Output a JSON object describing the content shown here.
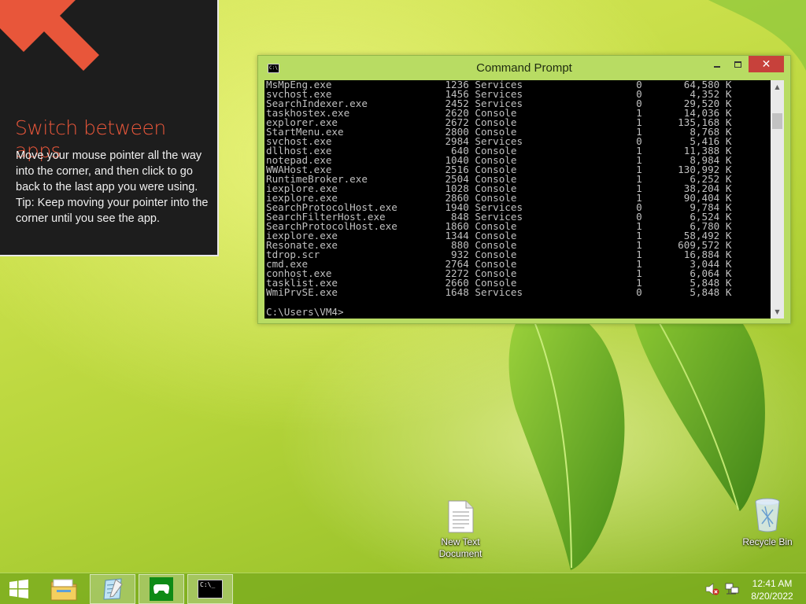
{
  "tip": {
    "title": "Switch between apps",
    "body_lines": [
      "Move your mouse pointer all the way into the corner, and then click to go back to the last app you were using.",
      "Tip: Keep moving your pointer into the corner until you see the app."
    ],
    "arrow_icon": "corner-arrow-icon",
    "accent_color": "#e8563a"
  },
  "cmd": {
    "title": "Command Prompt",
    "rows": [
      [
        "MsMpEng.exe",
        "1236",
        "Services",
        "0",
        "64,580 K"
      ],
      [
        "svchost.exe",
        "1456",
        "Services",
        "0",
        "4,352 K"
      ],
      [
        "SearchIndexer.exe",
        "2452",
        "Services",
        "0",
        "29,520 K"
      ],
      [
        "taskhostex.exe",
        "2620",
        "Console",
        "1",
        "14,036 K"
      ],
      [
        "explorer.exe",
        "2672",
        "Console",
        "1",
        "135,168 K"
      ],
      [
        "StartMenu.exe",
        "2800",
        "Console",
        "1",
        "8,768 K"
      ],
      [
        "svchost.exe",
        "2984",
        "Services",
        "0",
        "5,416 K"
      ],
      [
        "dllhost.exe",
        "640",
        "Console",
        "1",
        "11,388 K"
      ],
      [
        "notepad.exe",
        "1040",
        "Console",
        "1",
        "8,984 K"
      ],
      [
        "WWAHost.exe",
        "2516",
        "Console",
        "1",
        "130,992 K"
      ],
      [
        "RuntimeBroker.exe",
        "2504",
        "Console",
        "1",
        "6,252 K"
      ],
      [
        "iexplore.exe",
        "1028",
        "Console",
        "1",
        "38,204 K"
      ],
      [
        "iexplore.exe",
        "2860",
        "Console",
        "1",
        "90,404 K"
      ],
      [
        "SearchProtocolHost.exe",
        "1940",
        "Services",
        "0",
        "9,784 K"
      ],
      [
        "SearchFilterHost.exe",
        "848",
        "Services",
        "0",
        "6,524 K"
      ],
      [
        "SearchProtocolHost.exe",
        "1860",
        "Console",
        "1",
        "6,780 K"
      ],
      [
        "iexplore.exe",
        "1344",
        "Console",
        "1",
        "58,492 K"
      ],
      [
        "Resonate.exe",
        "880",
        "Console",
        "1",
        "609,572 K"
      ],
      [
        "tdrop.scr",
        "932",
        "Console",
        "1",
        "16,884 K"
      ],
      [
        "cmd.exe",
        "2764",
        "Console",
        "1",
        "3,044 K"
      ],
      [
        "conhost.exe",
        "2272",
        "Console",
        "1",
        "6,064 K"
      ],
      [
        "tasklist.exe",
        "2660",
        "Console",
        "1",
        "5,848 K"
      ],
      [
        "WmiPrvSE.exe",
        "1648",
        "Services",
        "0",
        "5,848 K"
      ]
    ],
    "prompt": "C:\\Users\\VM4>",
    "sys_icon_text": "C:\\",
    "minimize_icon": "minimize-icon",
    "maximize_icon": "maximize-icon",
    "close_label": "✕"
  },
  "desktop": {
    "icons": [
      {
        "label_line1": "New Text",
        "label_line2": "Document",
        "icon": "text-document-icon"
      },
      {
        "label_line1": "Recycle Bin",
        "label_line2": "",
        "icon": "recycle-bin-icon"
      }
    ]
  },
  "taskbar": {
    "start_icon": "windows-start-icon",
    "apps": [
      {
        "icon": "file-explorer-icon"
      },
      {
        "icon": "notepad-icon"
      },
      {
        "icon": "xbox-games-icon"
      },
      {
        "icon": "command-prompt-icon",
        "active": true,
        "icon_text": "C:\\_"
      }
    ],
    "tray": {
      "volume_icon": "volume-muted-icon",
      "network_icon": "network-icon"
    },
    "clock": {
      "time": "12:41 AM",
      "date": "8/20/2022"
    }
  }
}
